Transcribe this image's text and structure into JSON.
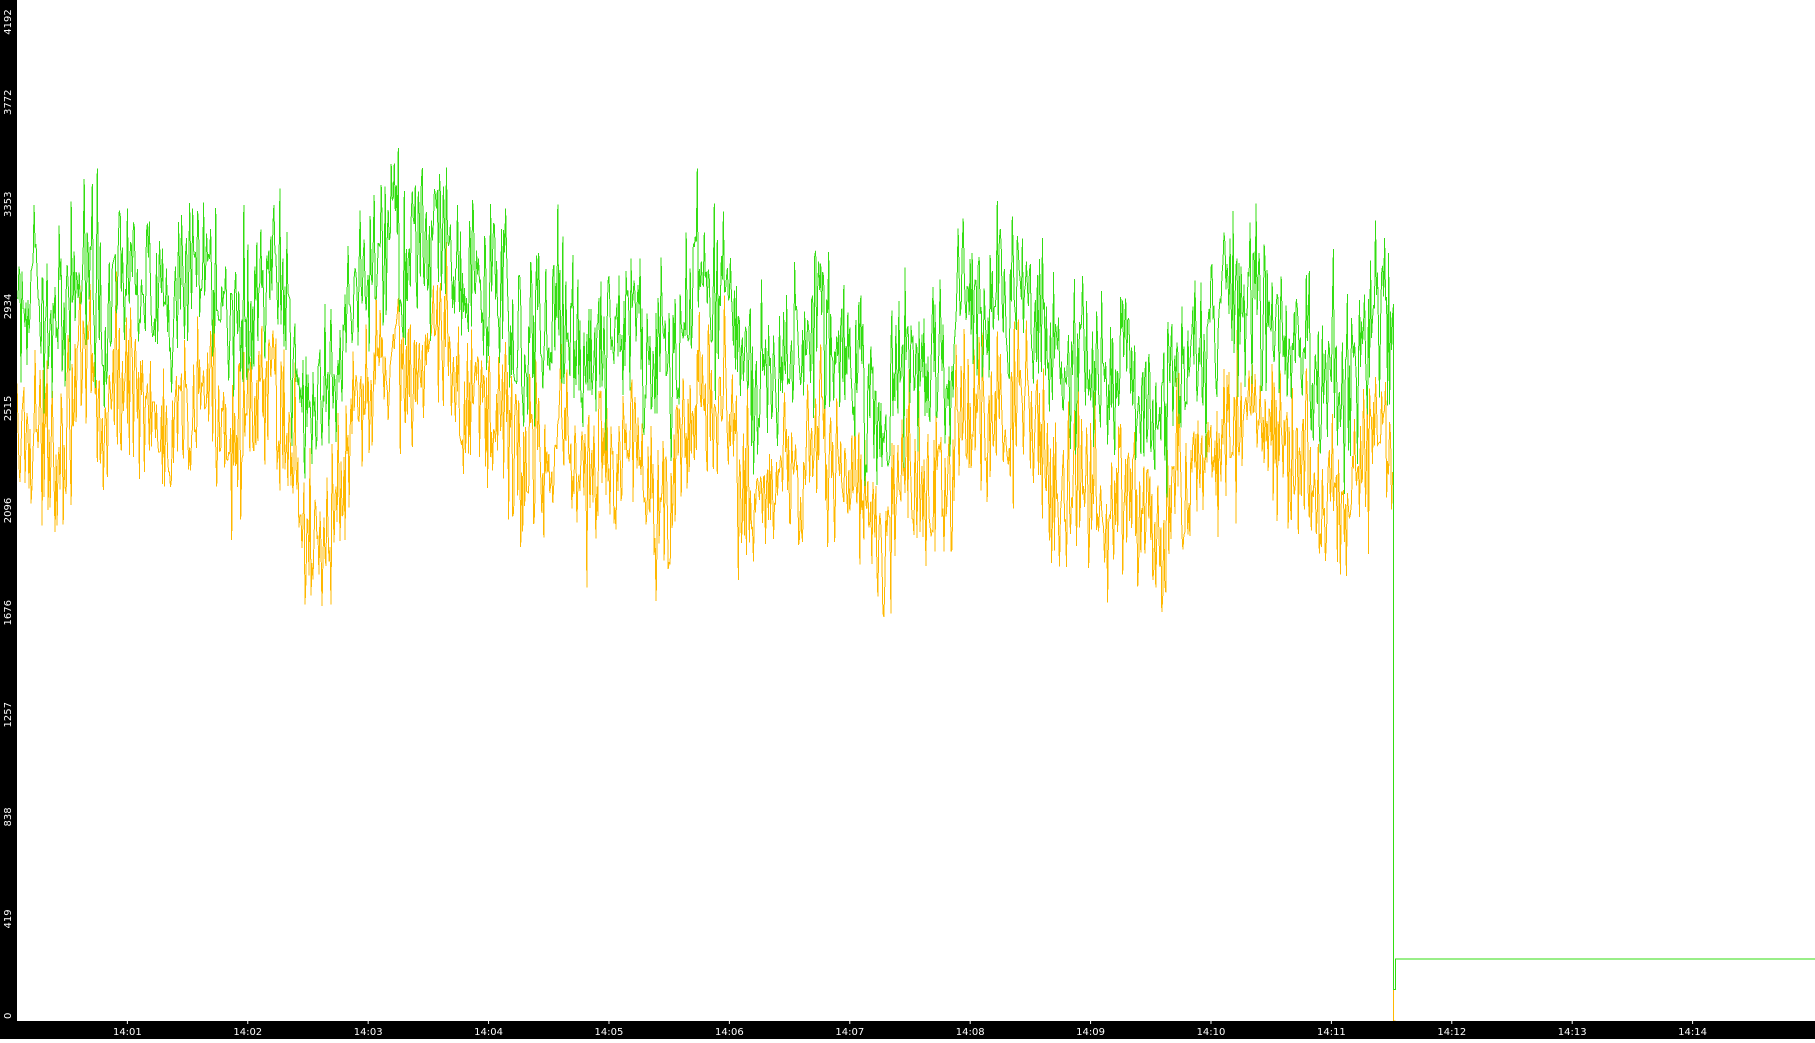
{
  "chart_data": {
    "type": "line",
    "title": "",
    "xlabel": "",
    "ylabel": "",
    "grid": false,
    "legend": "none",
    "background_color": "#ffffff",
    "axis_bar_color": "#000000",
    "tick_label_color": "#ffffff",
    "ylim": [
      0,
      4192
    ],
    "xlim": [
      "14:00:05",
      "14:15:01"
    ],
    "y_ticks": [
      0,
      419,
      838,
      1257,
      1676,
      2096,
      2515,
      2934,
      3353,
      3772,
      4192
    ],
    "x_ticks": [
      "14:01",
      "14:02",
      "14:03",
      "14:04",
      "14:05",
      "14:06",
      "14:07",
      "14:08",
      "14:09",
      "14:10",
      "14:11",
      "14:12",
      "14:13",
      "14:14"
    ],
    "series": [
      {
        "color": "#ffb800",
        "stats": {
          "mean": 2350,
          "spread": 420,
          "noise": 500,
          "min": 700,
          "max": 4000
        },
        "segments": [
          {
            "start": "14:00:05",
            "end": "14:11:31",
            "mode": "noisy"
          },
          {
            "start": "14:11:31",
            "end": "14:11:32",
            "mode": "drop",
            "value": 0
          }
        ]
      },
      {
        "color": "#33dd11",
        "stats": {
          "mean": 2850,
          "spread": 400,
          "noise": 520,
          "min": 1350,
          "max": 4192
        },
        "segments": [
          {
            "start": "14:00:05",
            "end": "14:11:31",
            "mode": "noisy"
          },
          {
            "start": "14:11:31",
            "end": "14:11:32",
            "mode": "drop",
            "value": 130
          },
          {
            "start": "14:11:32",
            "end": "14:15:01",
            "mode": "flat",
            "value": 255
          }
        ]
      }
    ]
  }
}
